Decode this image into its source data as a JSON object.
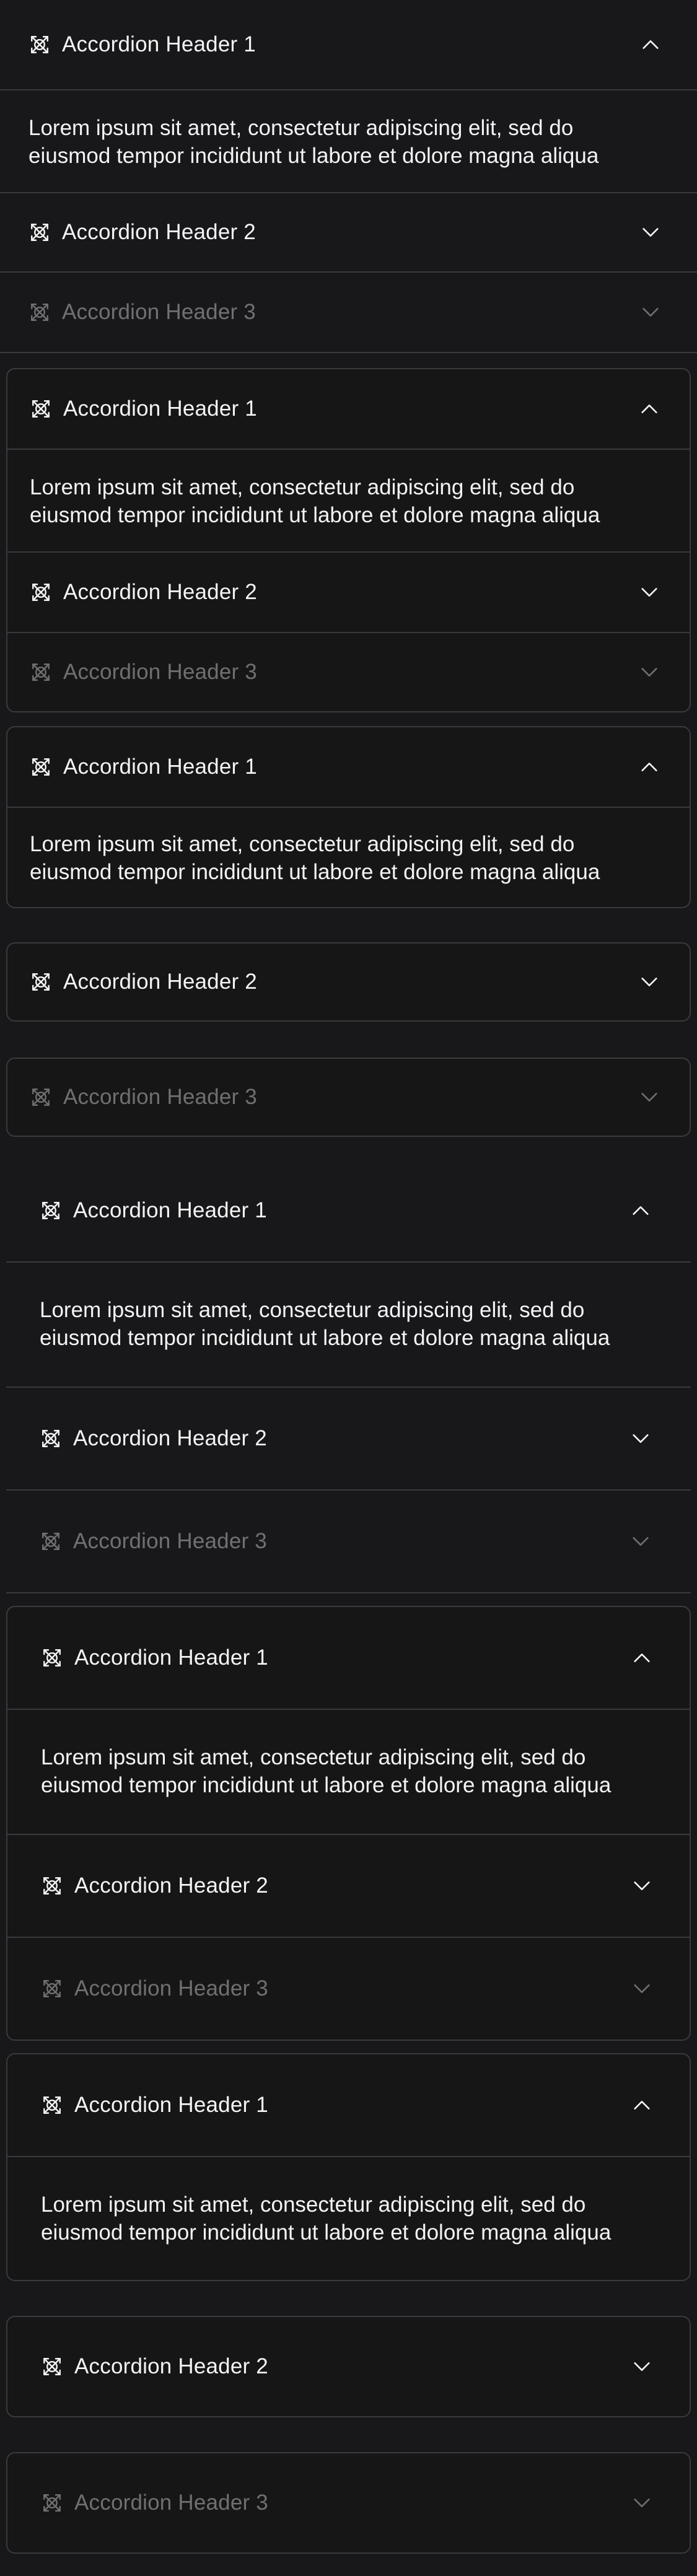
{
  "accordion": {
    "header1": "Accordion Header 1",
    "header2": "Accordion Header 2",
    "header3": "Accordion Header 3",
    "body": "Lorem ipsum sit amet, consectetur adipiscing elit, sed do eiusmod tempor incididunt ut labore et dolore magna aliqua"
  },
  "icons": {
    "leading": "placeholder-x-icon",
    "expanded": "chevron-up-icon",
    "collapsed": "chevron-down-icon"
  },
  "colors": {
    "background": "#18181a",
    "border": "#3a3a3d",
    "text": "#f4f4f5",
    "disabled_text": "#6b6b70"
  }
}
